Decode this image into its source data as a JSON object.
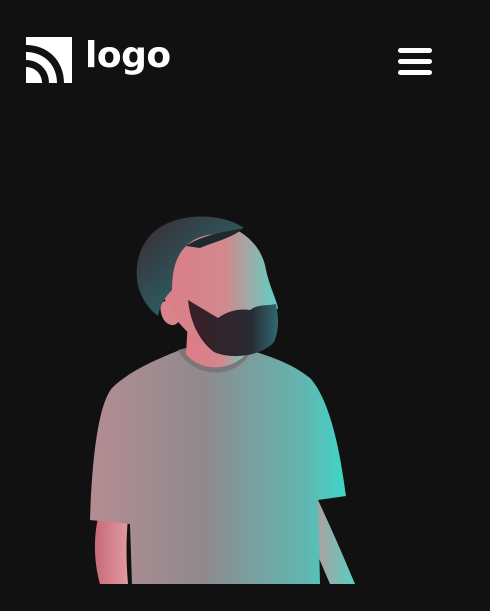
{
  "header": {
    "logo_text": "logo",
    "logo_icon": "rss-wave-icon",
    "menu_icon": "hamburger-menu-icon"
  },
  "hero": {
    "image": "bearded-man-looking-up-portrait",
    "colors": {
      "background": "#111111",
      "accent_cyan": "#3fe0d0",
      "accent_pink": "#e0607a",
      "shirt": "#8e8a8c"
    }
  }
}
